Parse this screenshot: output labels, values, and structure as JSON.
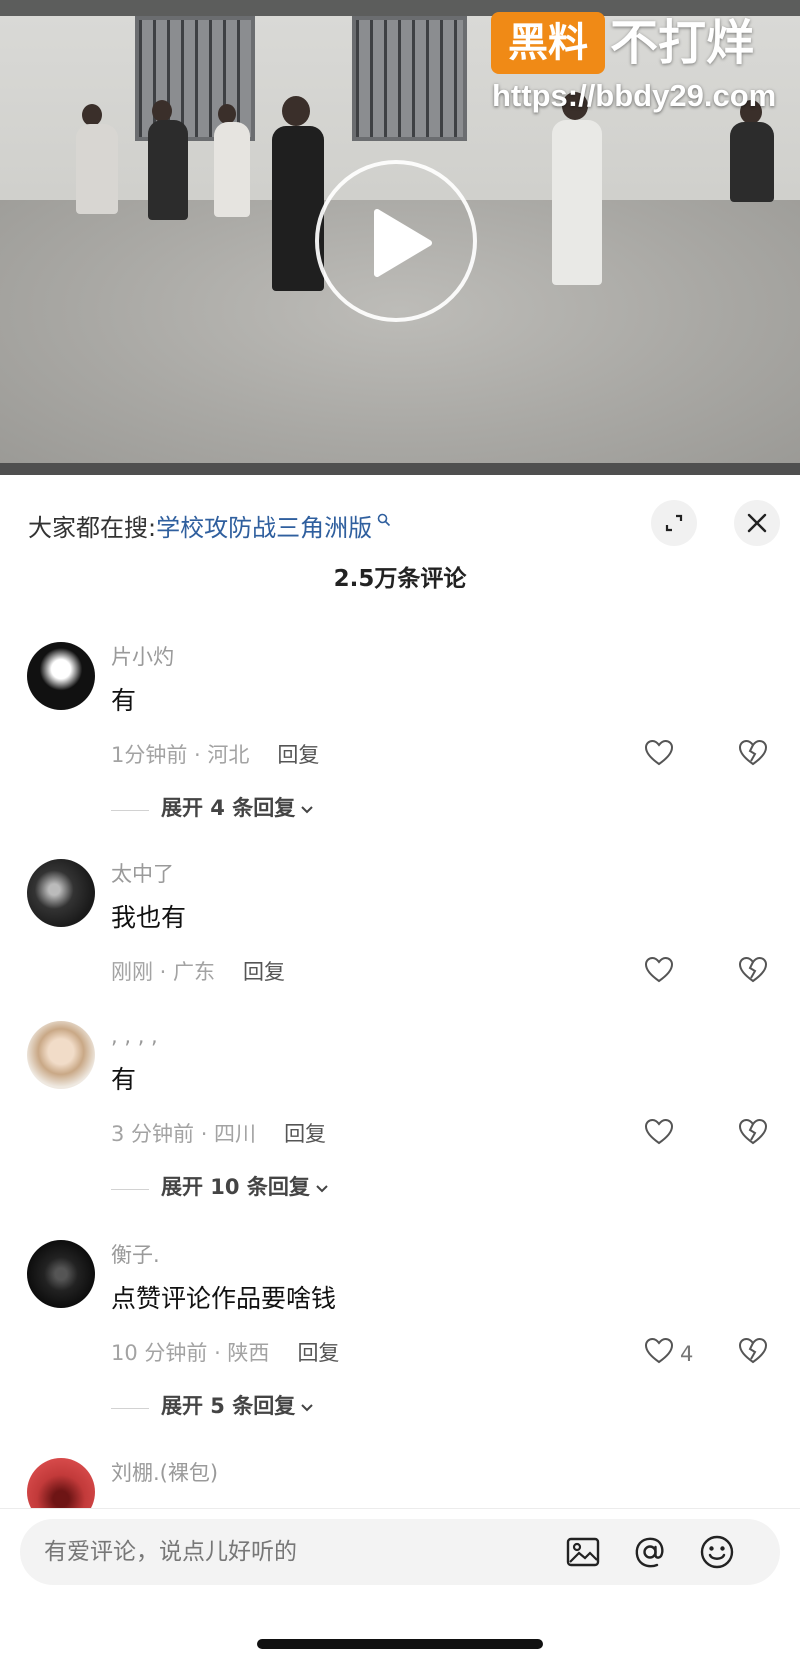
{
  "watermark": {
    "badge_text": "黑料",
    "brand_text": "不打烊",
    "url": "https://bbdy29.com",
    "badge_color": "#f08a16"
  },
  "video": {
    "play_icon": "play-icon"
  },
  "header": {
    "search_label": "大家都在搜:",
    "search_term": "学校攻防战三角洲版",
    "search_icon": "magnifier-icon",
    "expand_icon": "expand-icon",
    "close_icon": "close-icon",
    "comment_count_title": "2.5万条评论",
    "link_color": "#2f5f9e"
  },
  "comments": [
    {
      "name": "片小灼",
      "text": "有",
      "meta": "1分钟前 · 河北",
      "reply_label": "回复",
      "like_count": "",
      "expand_label": "展开 4 条回复"
    },
    {
      "name": "太中了",
      "text": "我也有",
      "meta": "刚刚 · 广东",
      "reply_label": "回复",
      "like_count": "",
      "expand_label": ""
    },
    {
      "name": ", , , ,",
      "text": "有",
      "meta": "3 分钟前 · 四川",
      "reply_label": "回复",
      "like_count": "",
      "expand_label": "展开 10 条回复"
    },
    {
      "name": "衡子.",
      "text": "点赞评论作品要啥钱",
      "meta": "10 分钟前 · 陕西",
      "reply_label": "回复",
      "like_count": "4",
      "expand_label": "展开 5 条回复"
    },
    {
      "name": "刘棚.(裸包)",
      "text": "",
      "meta": "",
      "reply_label": "",
      "like_count": "",
      "expand_label": ""
    }
  ],
  "input_bar": {
    "placeholder": "有爱评论，说点儿好听的",
    "icons": [
      "image-icon",
      "at-icon",
      "emoji-icon"
    ]
  }
}
